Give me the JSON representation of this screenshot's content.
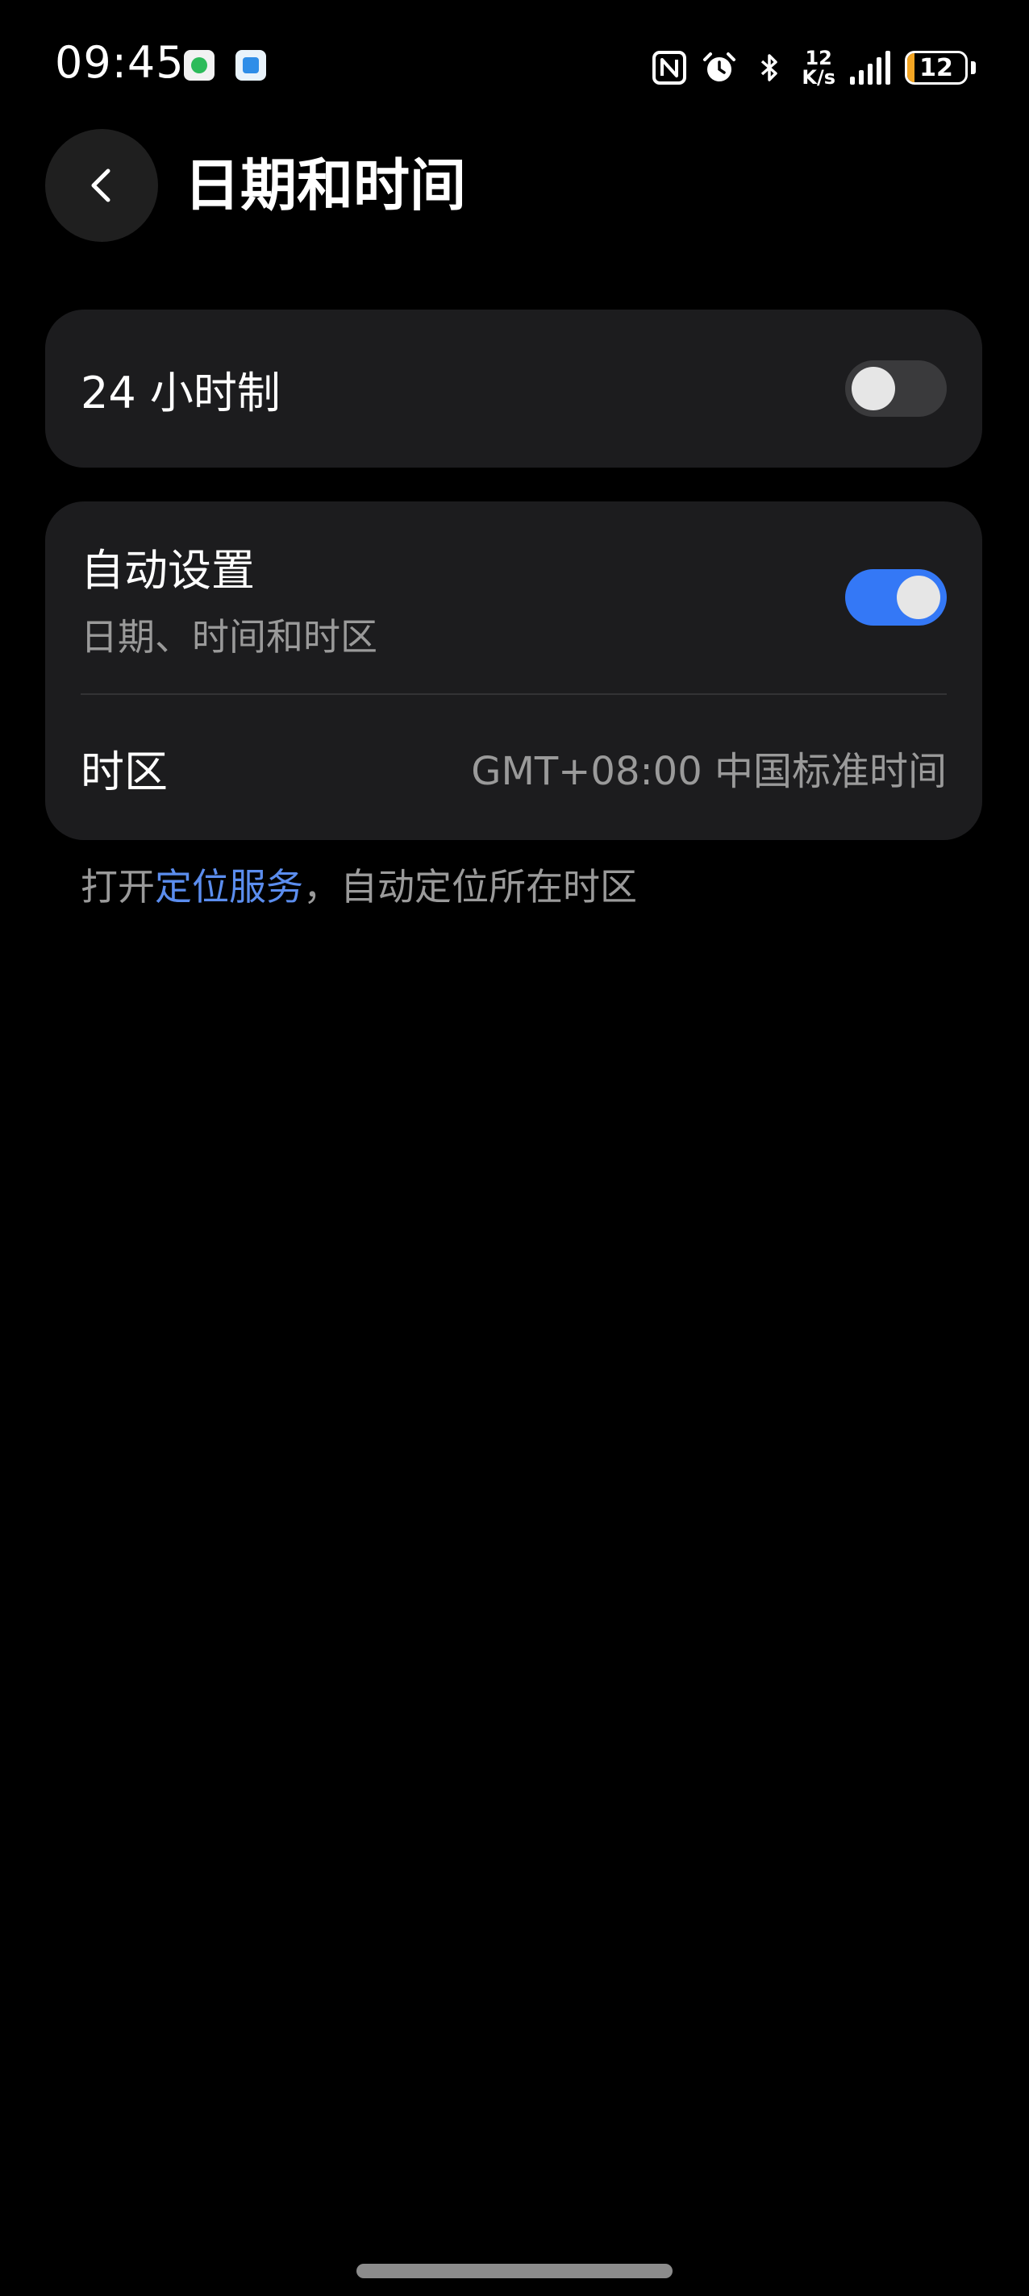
{
  "status_bar": {
    "time": "09:45",
    "notification_icons": [
      "app-icon-green",
      "app-icon-blue"
    ],
    "right_icons": [
      "nfc-icon",
      "alarm-icon",
      "bluetooth-icon"
    ],
    "network_speed_value": "12",
    "network_speed_unit": "K/s",
    "signal_level": 5,
    "battery_level": "12",
    "battery_fraction": 0.12,
    "battery_color": "#f5a623"
  },
  "header": {
    "title": "日期和时间",
    "back_icon": "chevron-left-icon"
  },
  "settings": {
    "hour24": {
      "label": "24 小时制",
      "enabled": false
    },
    "auto_set": {
      "label": "自动设置",
      "sublabel": "日期、时间和时区",
      "enabled": true,
      "accent_color": "#3478f6"
    },
    "timezone": {
      "label": "时区",
      "value": "GMT+08:00 中国标准时间"
    }
  },
  "footnote": {
    "prefix": "打开",
    "link": "定位服务",
    "suffix": "，自动定位所在时区",
    "link_color": "#5b8dee"
  }
}
